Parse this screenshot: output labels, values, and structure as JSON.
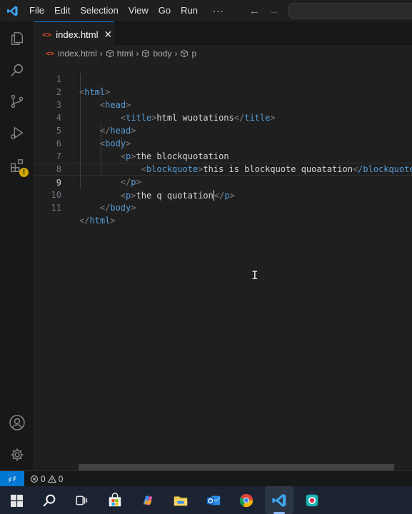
{
  "menu": [
    "File",
    "Edit",
    "Selection",
    "View",
    "Go",
    "Run"
  ],
  "menu_more": "···",
  "nav": {
    "back": "←",
    "forward": "→"
  },
  "tab": {
    "label": "index.html",
    "close": "✕",
    "file_icon": "<>"
  },
  "breadcrumb": {
    "file": "index.html",
    "crumbs": [
      "html",
      "body",
      "p"
    ],
    "sep": "›"
  },
  "editor": {
    "lines": [
      {
        "n": "1"
      },
      {
        "n": "2"
      },
      {
        "n": "3"
      },
      {
        "n": "4"
      },
      {
        "n": "5"
      },
      {
        "n": "6"
      },
      {
        "n": "7"
      },
      {
        "n": "8"
      },
      {
        "n": "9"
      },
      {
        "n": "10"
      },
      {
        "n": "11"
      }
    ],
    "code": {
      "l3_text": "html wuotations",
      "l6_text": "the blockquotation",
      "l7_text": "this is blockquote quoatation",
      "l7_close_tag": "/blockquote",
      "l9_text": "the q quotation"
    },
    "current_line": 9
  },
  "status": {
    "remote_icon": "><",
    "errors": "0",
    "warnings": "0"
  },
  "icons": {
    "activity": [
      "explorer-icon",
      "search-icon",
      "source-control-icon",
      "run-debug-icon",
      "extensions-icon",
      "accounts-icon",
      "manage-gear-icon"
    ],
    "taskbar": [
      "windows-start-icon",
      "search-icon",
      "task-view-icon",
      "store-icon",
      "copilot-icon",
      "file-explorer-icon",
      "outlook-icon",
      "chrome-icon",
      "vscode-icon",
      "snipping-tool-icon"
    ]
  },
  "colors": {
    "accent": "#0078d4",
    "tag": "#569cd6",
    "bracket": "#808080",
    "warn": "#cca700"
  }
}
